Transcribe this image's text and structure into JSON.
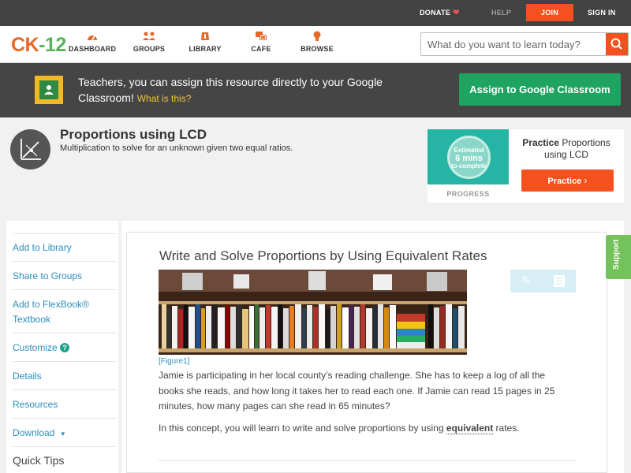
{
  "topbar": {
    "donate": "DONATE",
    "help": "HELP",
    "join": "JOIN",
    "signin": "SIGN IN"
  },
  "nav": {
    "logo_part1": "CK",
    "logo_part2": "-12",
    "items": [
      {
        "label": "DASHBOARD",
        "icon": "dashboard-icon"
      },
      {
        "label": "GROUPS",
        "icon": "groups-icon"
      },
      {
        "label": "LIBRARY",
        "icon": "library-icon"
      },
      {
        "label": "CAFE",
        "icon": "cafe-icon"
      },
      {
        "label": "BROWSE",
        "icon": "browse-icon"
      }
    ],
    "search_placeholder": "What do you want to learn today?"
  },
  "banner": {
    "text": "Teachers, you can assign this resource directly to your Google Classroom!",
    "what_link": "What is this?",
    "assign_button": "Assign to Google Classroom"
  },
  "concept": {
    "title": "Proportions using LCD",
    "subtitle": "Multiplication to solve for an unknown given two equal ratios."
  },
  "practice": {
    "estimated": "Estimated",
    "mins": "6 mins",
    "to_complete": "to complete",
    "progress_label": "PROGRESS",
    "label_bold": "Practice",
    "label_rest": "Proportions using LCD",
    "button": "Practice"
  },
  "sidebar": {
    "items": [
      {
        "label": "Add to Library"
      },
      {
        "label": "Share to Groups"
      },
      {
        "label": "Add to FlexBook® Textbook"
      },
      {
        "label": "Customize"
      },
      {
        "label": "Details"
      },
      {
        "label": "Resources"
      },
      {
        "label": "Download"
      }
    ],
    "quick_tips": "Quick Tips"
  },
  "article": {
    "title": "Write and Solve Proportions by Using Equivalent Rates",
    "figure_caption": "[Figure1]",
    "paragraph1": "Jamie is participating in her local county’s reading challenge. She has to keep a log of all the books she reads, and how long it takes her to read each one. If Jamie can read 15 pages in 25 minutes, how many pages can she read in 65 minutes?",
    "paragraph2_before": "In this concept, you will learn to write and solve proportions by using ",
    "paragraph2_keyword": "equivalent",
    "paragraph2_after": " rates."
  },
  "support_tab": "Support",
  "colors": {
    "accent_orange": "#f4511e",
    "google_green": "#1fa361",
    "link_blue": "#2a8fbd",
    "support_green": "#73c25b"
  }
}
